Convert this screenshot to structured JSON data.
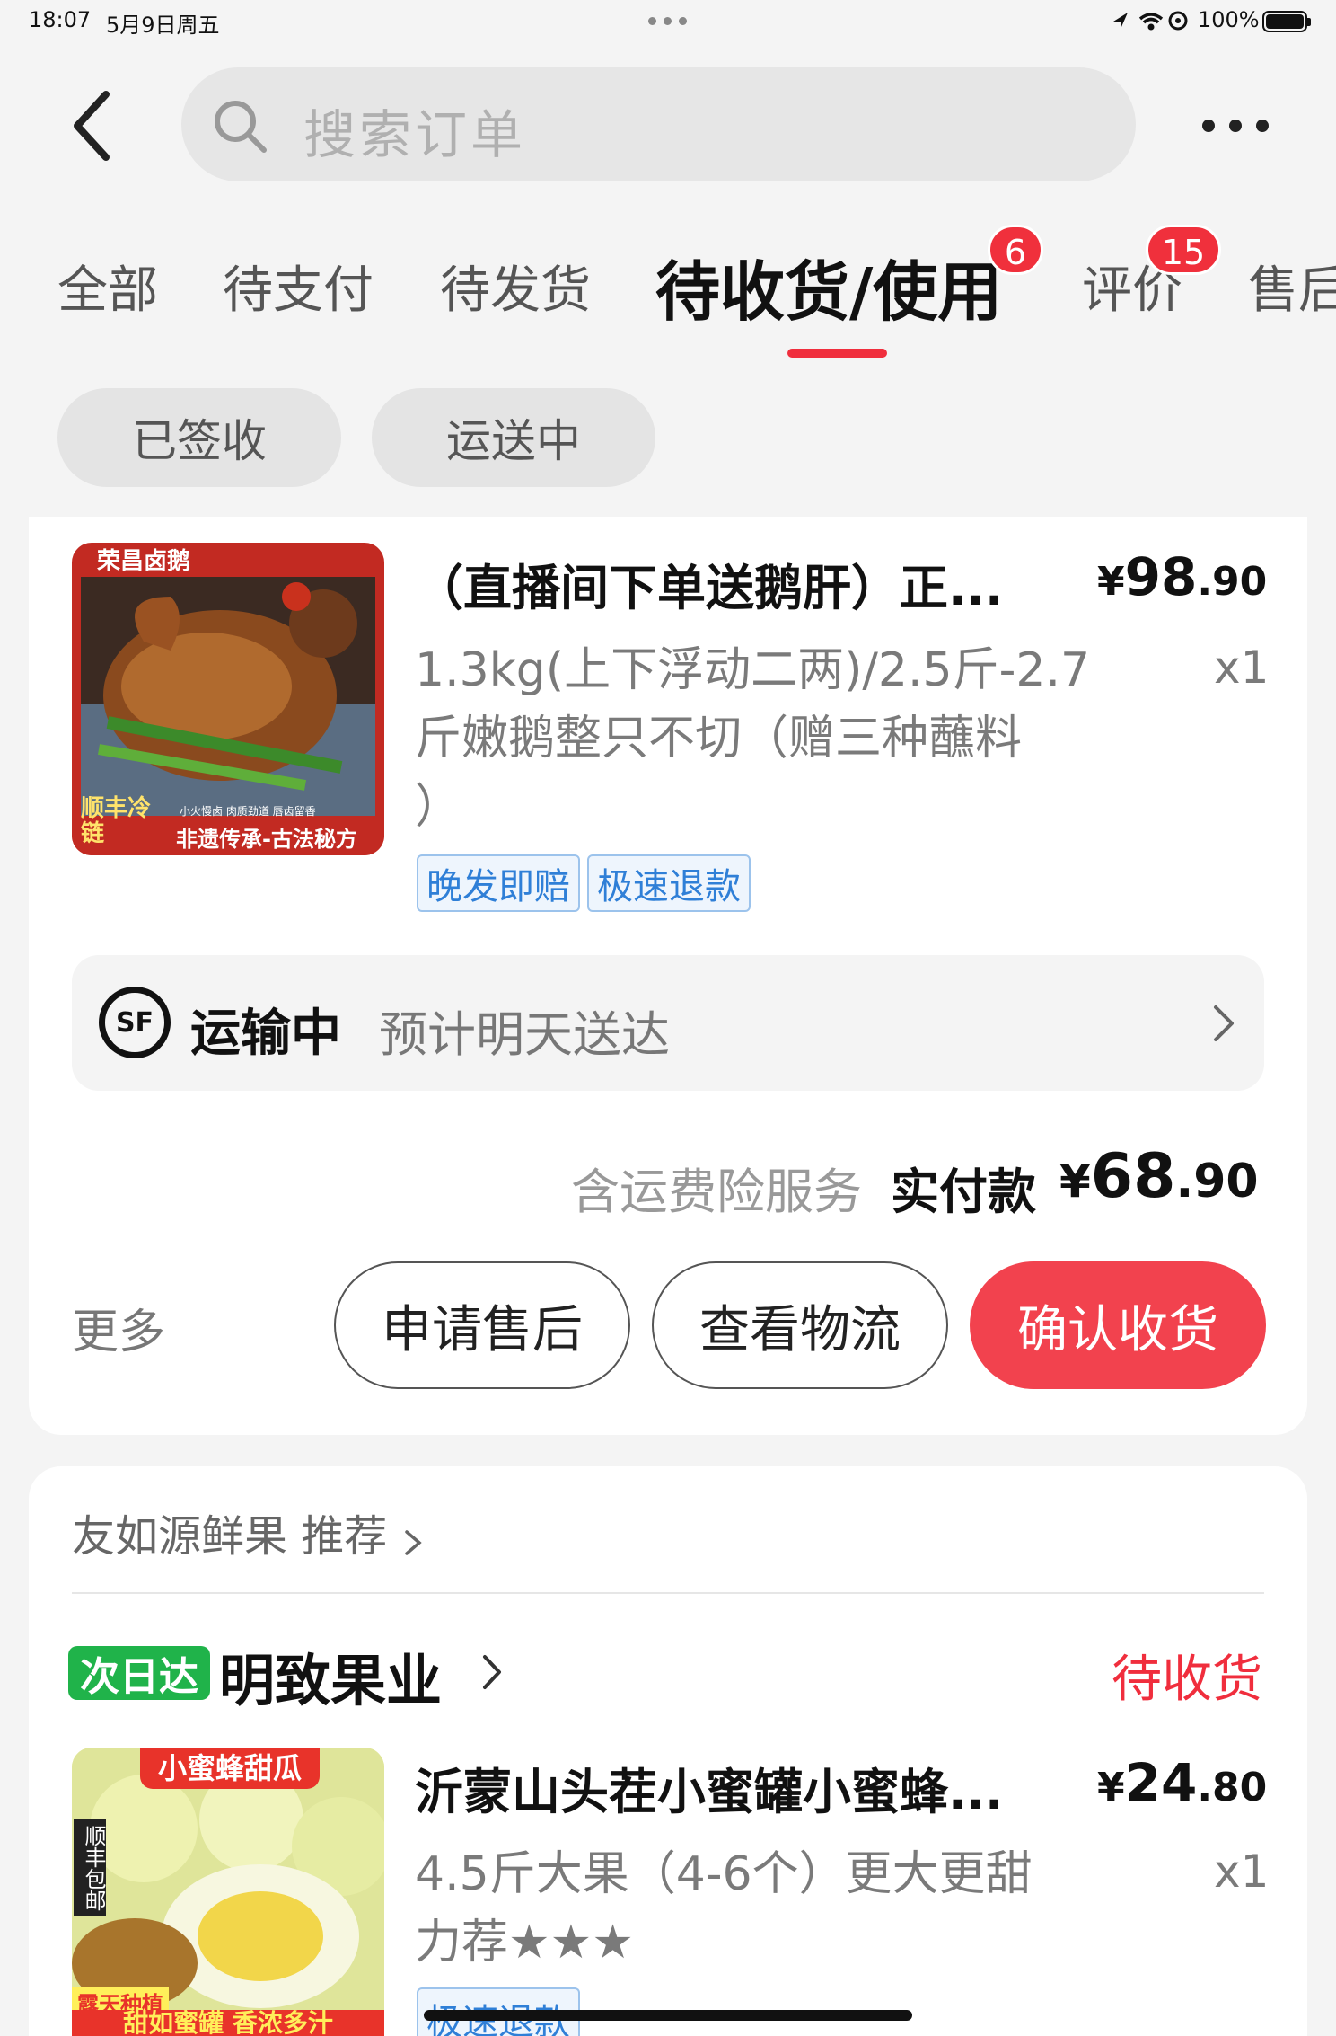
{
  "status_bar": {
    "time": "18:07",
    "date": "5月9日周五",
    "battery": "100%"
  },
  "header": {
    "search_placeholder": "搜索订单"
  },
  "tabs": [
    {
      "label": "全部"
    },
    {
      "label": "待支付"
    },
    {
      "label": "待发货"
    },
    {
      "label": "待收货/使用",
      "badge": "6",
      "active": true
    },
    {
      "label": "评价",
      "badge": "15"
    },
    {
      "label": "售后"
    }
  ],
  "chips": [
    "已签收",
    "运送中"
  ],
  "order1": {
    "thumb": {
      "brand": "荣昌卤鹅",
      "corner": "顺丰冷链",
      "slogan": "非遗传承-古法秘方",
      "sub": "小火慢卤 肉质劲道 唇齿留香"
    },
    "title": "（直播间下单送鹅肝）正...",
    "price": {
      "yen": "¥",
      "int": "98",
      "dec": ".90"
    },
    "spec": [
      "1.3kg(上下浮动二两)/2.5斤-2.7",
      "斤嫩鹅整只不切（赠三种蘸料",
      "）"
    ],
    "qty": "x1",
    "tags": [
      "晚发即赔",
      "极速退款"
    ],
    "shipping": {
      "carrier": "SF",
      "status": "运输中",
      "eta": "预计明天送达"
    },
    "payment": {
      "note": "含运费险服务",
      "label": "实付款",
      "yen": "¥",
      "int": "68",
      "dec": ".90"
    },
    "more": "更多",
    "buttons": {
      "after_sale": "申请售后",
      "logistics": "查看物流",
      "confirm": "确认收货"
    }
  },
  "recommend": {
    "label": "友如源鲜果 推荐"
  },
  "order2": {
    "badge": "次日达",
    "store": "明致果业",
    "status": "待收货",
    "thumb": {
      "title": "小蜜蜂甜瓜",
      "side": "顺丰包邮",
      "bottom": "甜如蜜罐 香浓多汁",
      "corner": "露天种植"
    },
    "title": "沂蒙山头茬小蜜罐小蜜蜂...",
    "price": {
      "yen": "¥",
      "int": "24",
      "dec": ".80"
    },
    "spec": [
      "4.5斤大果（4-6个）更大更甜",
      "力荐★★★"
    ],
    "qty": "x1",
    "tags": [
      "极速退款"
    ]
  },
  "colors": {
    "accent": "#f02e3d",
    "tag_blue": "#2f7fd7",
    "green": "#20b34a"
  }
}
